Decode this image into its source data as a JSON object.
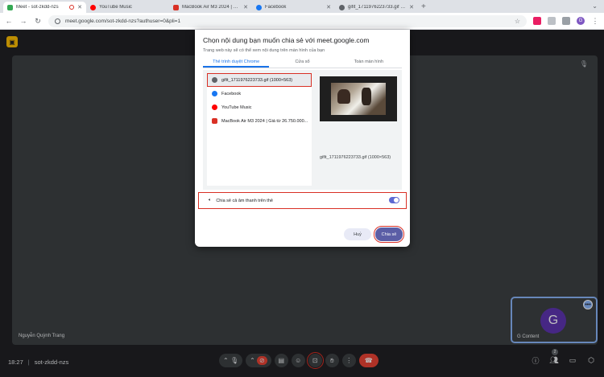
{
  "browser": {
    "tabs": [
      {
        "title": "Meet - sot-zkdd-nzs",
        "favicon_color": "#34a853",
        "active": true
      },
      {
        "title": "YouTube Music",
        "favicon_color": "#ff0000"
      },
      {
        "title": "MacBook Air M3 2024 | Giá từ",
        "favicon_color": "#d93025"
      },
      {
        "title": "Facebook",
        "favicon_color": "#1877f2"
      },
      {
        "title": "gifit_1711976223733.gif (1000",
        "favicon_color": "#5f6368"
      }
    ],
    "new_tab": "+",
    "url": "meet.google.com/sot-zkdd-nzs?authuser=0&pli=1",
    "profile_initial": "G"
  },
  "meet": {
    "stage_participant": "Nguyễn Quỳnh Trang",
    "self_tile": {
      "avatar_initial": "G",
      "name": "G Content"
    },
    "time": "18:27",
    "meeting_code": "sot-zkdd-nzs",
    "participant_count": "2"
  },
  "dialog": {
    "title": "Chọn nội dung bạn muốn chia sẻ với meet.google.com",
    "subtitle": "Trang web này sẽ có thể xem nội dung trên màn hình của bạn",
    "tabs": [
      "Thẻ trình duyệt Chrome",
      "Cửa sổ",
      "Toàn màn hình"
    ],
    "active_tab": 0,
    "tab_list": [
      {
        "label": "gifit_1711976223733.gif (1000×563)",
        "icon_color": "#5f6368",
        "selected": true
      },
      {
        "label": "Facebook",
        "icon_color": "#1877f2"
      },
      {
        "label": "YouTube Music",
        "icon_color": "#ff0000"
      },
      {
        "label": "MacBook Air M3 2024 | Giá từ 26.750.000...",
        "icon_color": "#d93025"
      }
    ],
    "preview_caption": "gifit_1711976223733.gif (1000×563)",
    "audio_label": "Chia sẻ cả âm thanh trên thẻ",
    "audio_enabled": true,
    "cancel_label": "Huỷ",
    "share_label": "Chia sẻ"
  }
}
